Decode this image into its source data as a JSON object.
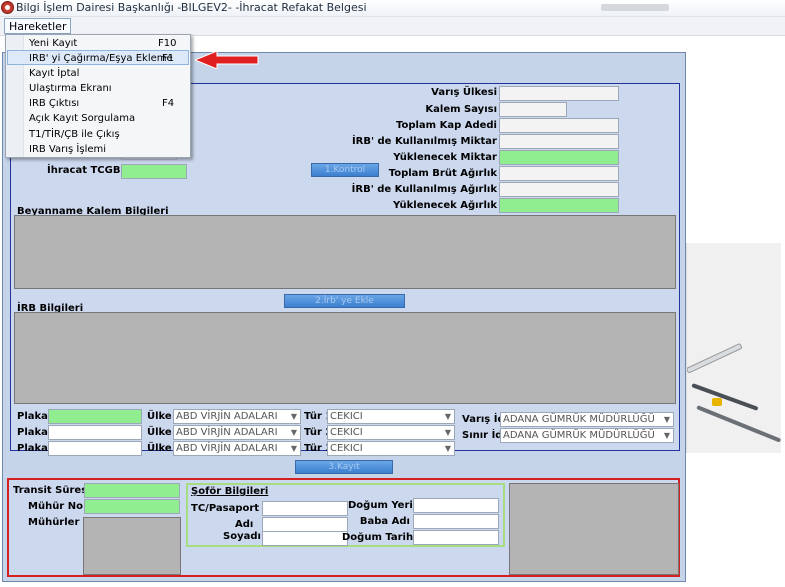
{
  "window": {
    "title": "Bilgi İşlem Dairesi Başkanlığı -BILGEV2- -İhracat Refakat Belgesi"
  },
  "menubar": {
    "hareketler": "Hareketler"
  },
  "dropdown": {
    "items": [
      {
        "label": "Yeni Kayıt",
        "shortcut": "F10"
      },
      {
        "label": "IRB' yi Çağırma/Eşya Ekleme",
        "shortcut": "F1"
      },
      {
        "label": "Kayıt İptal",
        "shortcut": ""
      },
      {
        "label": "Ulaştırma Ekranı",
        "shortcut": ""
      },
      {
        "label": "IRB Çıktısı",
        "shortcut": "F4"
      },
      {
        "label": "Açık Kayıt Sorgulama",
        "shortcut": ""
      },
      {
        "label": "T1/TİR/ÇB ile Çıkış",
        "shortcut": ""
      },
      {
        "label": "IRB Varış İşlemi",
        "shortcut": ""
      }
    ]
  },
  "form": {
    "ihracat_tcgb_label": "İhracat TCGB No",
    "kontrol_button": "1.Kontrol",
    "right_labels": {
      "varis_ulkesi": "Varış Ülkesi",
      "kalem_sayisi": "Kalem Sayısı",
      "toplam_kap": "Toplam Kap Adedi",
      "irb_kullanilmis_miktar": "İRB' de Kullanılmış Miktar",
      "yuklenecek_miktar": "Yüklenecek Miktar",
      "toplam_brut": "Toplam Brüt Ağırlık",
      "irb_kullanilmis_agirlik": "İRB' de Kullanılmış Ağırlık",
      "yuklenecek_agirlik": "Yüklenecek Ağırlık"
    },
    "beyanname_title": "Beyanname Kalem Bilgileri",
    "irb_ye_ekle_button": "2.İrb' ye Ekle",
    "irb_bilgileri_title": "İRB Bilgileri",
    "plaka1": "Plaka1",
    "plaka2": "Plaka2",
    "plaka3": "Plaka3",
    "ulke1": "Ülke 1",
    "ulke2": "Ülke 2",
    "ulke3": "Ülke 3",
    "ulke_value": "ABD VİRJİN ADALARI",
    "tur1": "Tür 1",
    "tur2": "Tür 2",
    "tur3": "Tür 3",
    "tur_value": "CEKICI",
    "varis_id": "Varış İd.",
    "sinir_id": "Sınır İd.",
    "gumruk_value": "ADANA GÜMRÜK MÜDÜRLÜĞÜ",
    "kayit_button": "3.Kayıt",
    "transit_suresi": "Transit Süresi",
    "muhur_no": "Mühür No",
    "muhurler": "Mühürler",
    "sofor_title": "Şoför Bilgileri",
    "tc_pasaport": "TC/Pasaport No",
    "adi": "Adı",
    "soyadi": "Soyadı",
    "dogum_yeri": "Doğum Yeri",
    "baba_adi": "Baba Adı",
    "dogum_tarihi": "Doğum Tarihi"
  },
  "colors": {
    "required_field": "#90ee90",
    "form_bg": "#c6d4ea",
    "arrow": "#e02020"
  }
}
